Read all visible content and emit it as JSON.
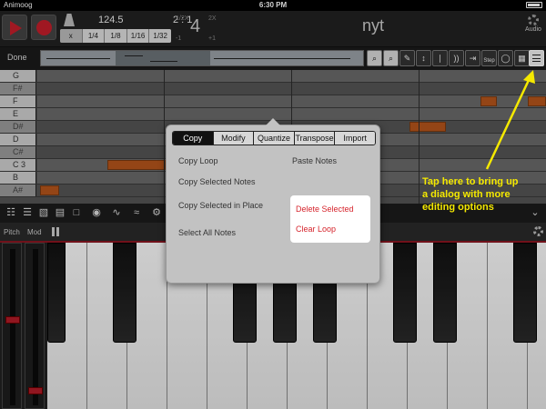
{
  "status_bar": {
    "carrier": "Animoog",
    "time": "6:30 PM",
    "battery": "battery"
  },
  "toolbar": {
    "play_icon": "play-icon",
    "record_icon": "record-icon",
    "metronome_icon": "metronome-icon",
    "tempo": "124.5",
    "time_signature": "2 : 1",
    "quantize_options": [
      "x",
      "1/4",
      "1/8",
      "1/16",
      "1/32"
    ],
    "zoom": {
      "half": "1/2X",
      "double": "2X",
      "value": "4",
      "minus": "-1",
      "plus": "+1"
    },
    "title": "nyt",
    "audio_label": "Audio"
  },
  "edit_bar": {
    "done_label": "Done",
    "tools": [
      "zoom-in-icon",
      "zoom-out-icon",
      "pencil-icon",
      "vertical-move-icon",
      "velocity-icon",
      "skip-end-icon",
      "step-label",
      "loop-icon",
      "lock-icon",
      "menu-icon"
    ],
    "step_label": "Step"
  },
  "piano_roll": {
    "keys": [
      {
        "label": "G",
        "sharp": false
      },
      {
        "label": "F#",
        "sharp": true
      },
      {
        "label": "F",
        "sharp": false
      },
      {
        "label": "E",
        "sharp": false
      },
      {
        "label": "D#",
        "sharp": true
      },
      {
        "label": "D",
        "sharp": false
      },
      {
        "label": "C#",
        "sharp": true
      },
      {
        "label": "C 3",
        "sharp": false
      },
      {
        "label": "B",
        "sharp": false
      },
      {
        "label": "A#",
        "sharp": true
      }
    ]
  },
  "popover": {
    "tabs": [
      "Copy",
      "Modify",
      "Quantize",
      "Transpose",
      "Import"
    ],
    "active_tab": "Copy",
    "items": {
      "copy_loop": "Copy Loop",
      "paste_notes": "Paste Notes",
      "copy_selected": "Copy Selected Notes",
      "copy_in_place": "Copy Selected in Place",
      "select_all": "Select All Notes",
      "delete_selected": "Delete Selected",
      "clear_loop": "Clear Loop"
    },
    "destructive_color": "#d6242c"
  },
  "keyboard": {
    "pitch_label": "Pitch",
    "mod_label": "Mod"
  },
  "annotation": {
    "line1": "Tap here to bring up",
    "line2": "a dialog with more",
    "line3": "editing options",
    "color": "#f5e900"
  },
  "colors": {
    "accent_red": "#c41e2a",
    "note_orange": "#b5551c"
  }
}
